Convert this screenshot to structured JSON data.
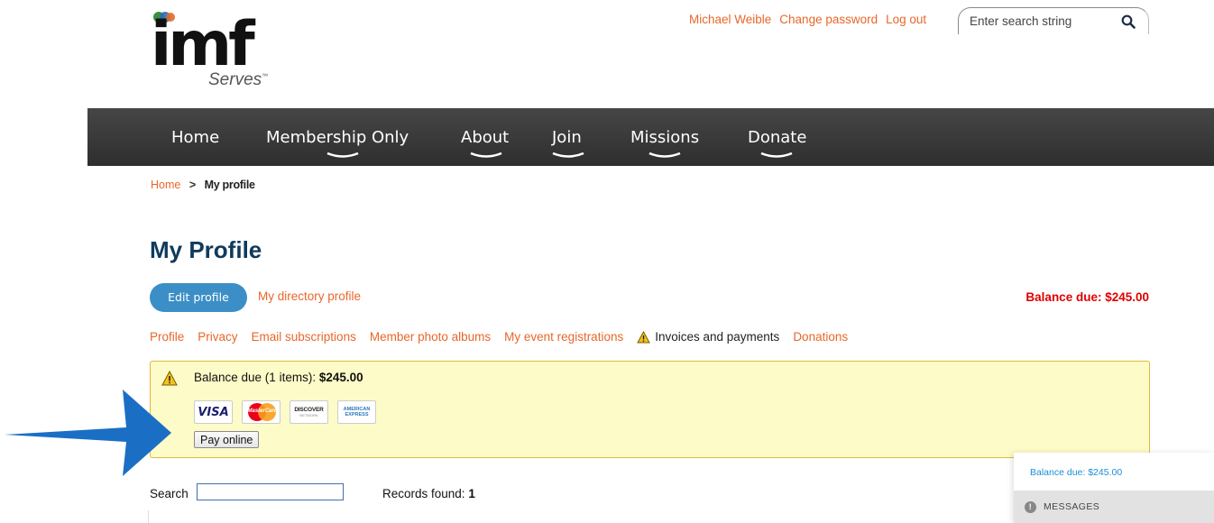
{
  "logo": {
    "main": "imf",
    "sub": "Serves",
    "tm": "™"
  },
  "header": {
    "user_name": "Michael Weible",
    "change_password": "Change password",
    "log_out": "Log out",
    "search_placeholder": "Enter search string"
  },
  "nav": {
    "items": [
      {
        "label": "Home"
      },
      {
        "label": "Membership Only"
      },
      {
        "label": "About"
      },
      {
        "label": "Join"
      },
      {
        "label": "Missions"
      },
      {
        "label": "Donate"
      }
    ]
  },
  "breadcrumb": {
    "home": "Home",
    "sep": ">",
    "current": "My profile"
  },
  "page": {
    "title": "My Profile",
    "edit_profile": "Edit profile",
    "directory_profile": "My directory profile",
    "balance_due": "Balance due: $245.00"
  },
  "tabs": {
    "items": [
      {
        "label": "Profile"
      },
      {
        "label": "Privacy"
      },
      {
        "label": "Email subscriptions"
      },
      {
        "label": "Member photo albums"
      },
      {
        "label": "My event registrations"
      },
      {
        "label": "Invoices and payments"
      },
      {
        "label": "Donations"
      }
    ],
    "active_index": 5
  },
  "balance_box": {
    "text": "Balance due (1 items):",
    "amount": "$245.00",
    "cards": {
      "visa": "VISA",
      "mastercard": "MasterCard",
      "discover": "DISCOVER",
      "discover_sub": "NETWORK",
      "amex_1": "AMERICAN",
      "amex_2": "EXPRESS"
    },
    "pay_button": "Pay online"
  },
  "records": {
    "search_label": "Search",
    "found_label": "Records found:",
    "count": "1"
  },
  "side_panel": {
    "balance": "Balance due: $245.00",
    "messages": "MESSAGES"
  },
  "colors": {
    "accent_orange": "#e8672a",
    "nav_bg": "#3a3a3a",
    "title_blue": "#0f3a5c",
    "button_blue": "#3c8fc6",
    "balance_red": "#e00000",
    "arrow_blue": "#1a6fc4",
    "warning_yellow": "#fdfbc8"
  }
}
